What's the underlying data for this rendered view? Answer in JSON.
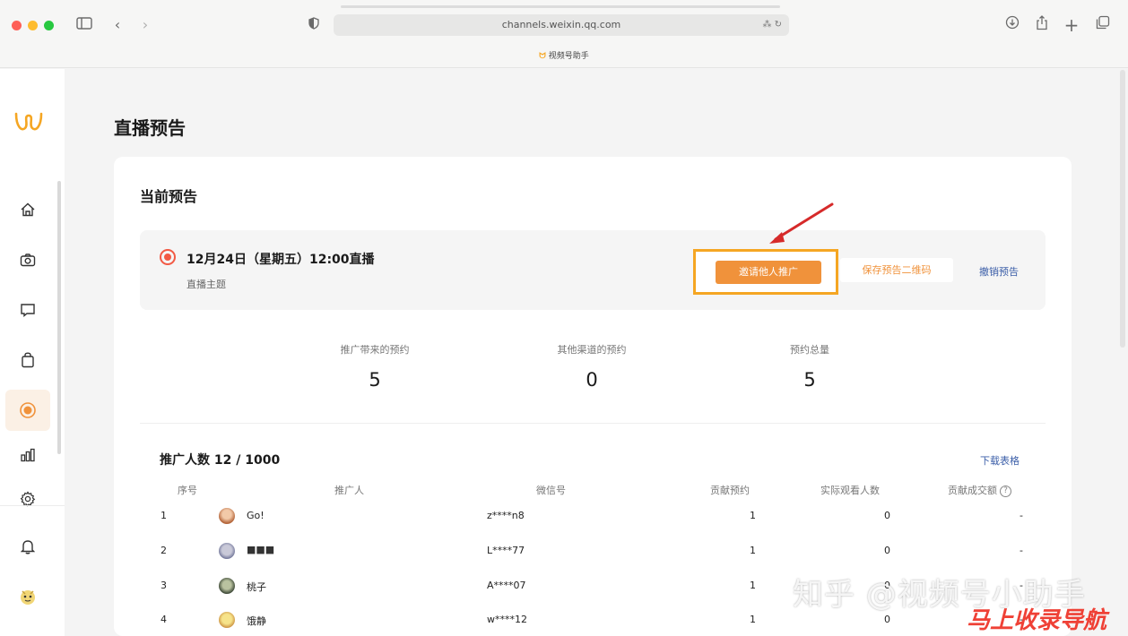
{
  "browser": {
    "url": "channels.weixin.qq.com",
    "tab_title": "视频号助手",
    "url_right_icons": "⁂ ↻"
  },
  "page": {
    "title": "直播预告",
    "section_title": "当前预告"
  },
  "notice": {
    "date_text": "12月24日（星期五）12:00直播",
    "subtitle": "直播主题",
    "invite_button": "邀请他人推广",
    "save_qr_button": "保存预告二维码",
    "cancel_link": "撤销预告"
  },
  "stats": [
    {
      "label": "推广带来的预约",
      "value": "5"
    },
    {
      "label": "其他渠道的预约",
      "value": "0"
    },
    {
      "label": "预约总量",
      "value": "5"
    }
  ],
  "promoters": {
    "count_text": "推广人数 12 / 1000",
    "download_link": "下载表格",
    "columns": [
      "序号",
      "推广人",
      "微信号",
      "贡献预约",
      "实际观看人数",
      "贡献成交额"
    ],
    "rows": [
      {
        "index": "1",
        "name": "Go!",
        "wechat": "z****n8",
        "reservations": "1",
        "viewers": "0",
        "gmv": "-"
      },
      {
        "index": "2",
        "name": "■■■",
        "wechat": "L****77",
        "reservations": "1",
        "viewers": "0",
        "gmv": "-"
      },
      {
        "index": "3",
        "name": "桃子",
        "wechat": "A****07",
        "reservations": "1",
        "viewers": "0",
        "gmv": "-"
      },
      {
        "index": "4",
        "name": "饿静",
        "wechat": "w****12",
        "reservations": "1",
        "viewers": "0",
        "gmv": "-"
      }
    ]
  },
  "watermark": {
    "line1": "知乎 @视频号小助手",
    "line2": "马上收录导航"
  },
  "colors": {
    "accent": "#f0923b",
    "highlight": "#f5a623",
    "link": "#3b5ea8",
    "live": "#f25a45"
  }
}
